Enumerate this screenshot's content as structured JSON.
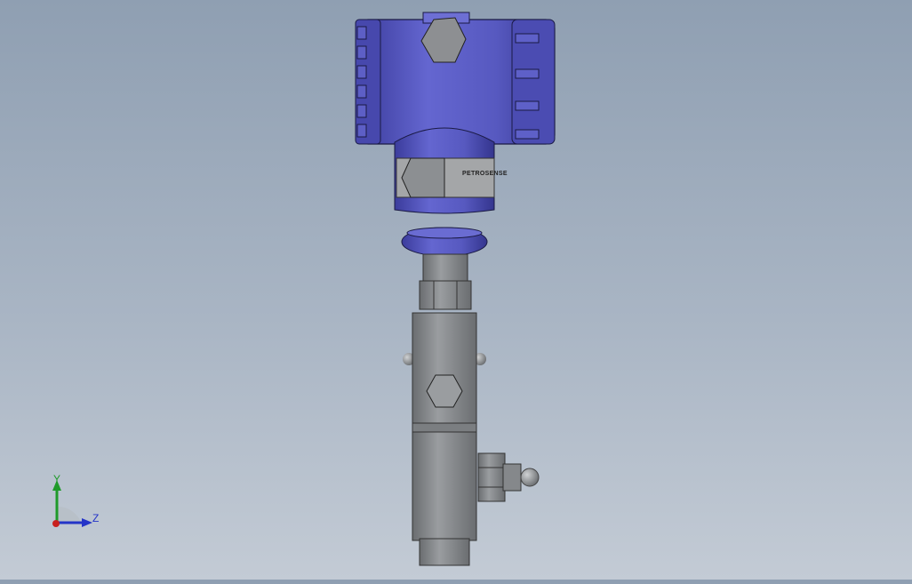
{
  "model": {
    "brand_text": "PETROSENSE"
  },
  "triad": {
    "y_label": "Y",
    "z_label": "Z",
    "y_color": "#1f9a2a",
    "z_color": "#2434c8",
    "x_color": "#c8201f"
  },
  "colors": {
    "housing": "#5a5cc4",
    "housing_dark": "#3a3a9a",
    "metal": "#8a8d90",
    "metal_dark": "#5f6265"
  }
}
